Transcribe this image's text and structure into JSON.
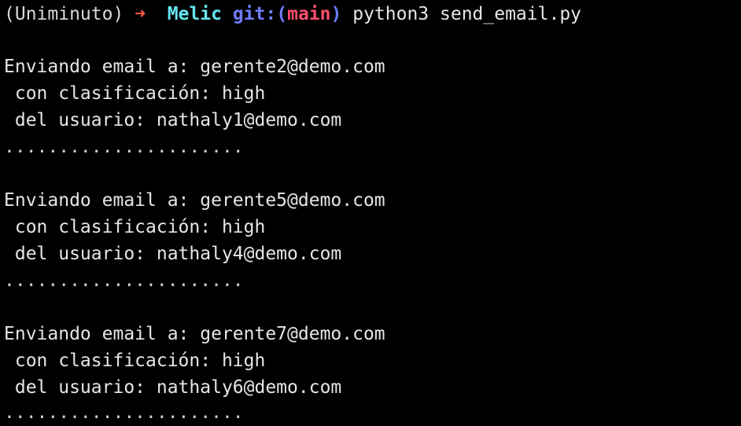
{
  "prompt": {
    "env": "(Uniminuto)",
    "arrow": "➜",
    "dir": "Melic",
    "git_label": "git:(",
    "branch": "main",
    "git_close": ")",
    "command": "python3 send_email.py"
  },
  "colors": {
    "background": "#000000",
    "text": "#e6e6e6",
    "arrow": "#ff5a4a",
    "dir": "#66e6f0",
    "git": "#6f7cff",
    "branch": "#ff4f6a"
  },
  "output": [
    {
      "to": "Enviando email a: gerente2@demo.com",
      "classification": " con clasificación: high",
      "user": " del usuario: nathaly1@demo.com",
      "separator": "......................"
    },
    {
      "to": "Enviando email a: gerente5@demo.com",
      "classification": " con clasificación: high",
      "user": " del usuario: nathaly4@demo.com",
      "separator": "......................"
    },
    {
      "to": "Enviando email a: gerente7@demo.com",
      "classification": " con clasificación: high",
      "user": " del usuario: nathaly6@demo.com",
      "separator": "......................"
    }
  ]
}
